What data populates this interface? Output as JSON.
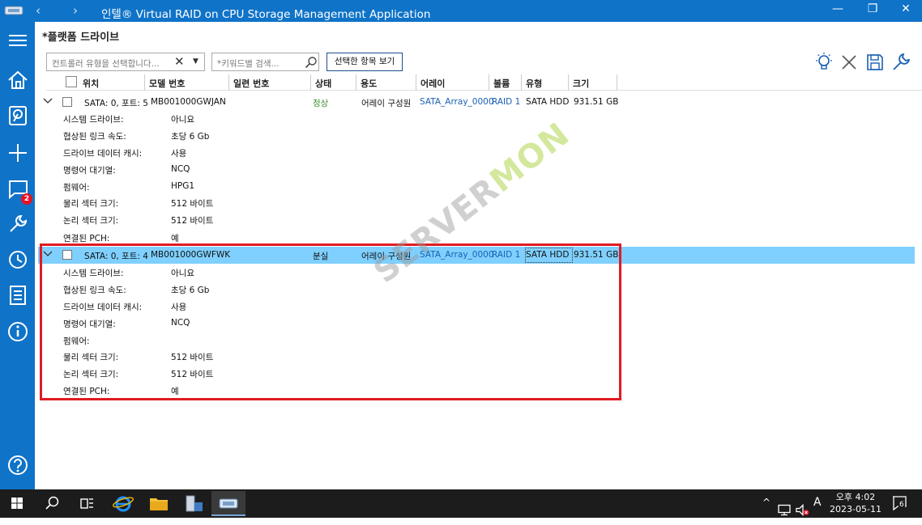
{
  "window": {
    "title": "인텔® Virtual RAID on CPU Storage Management Application",
    "back_glyph": "‹",
    "forward_glyph": "›",
    "minimize_glyph": "—",
    "restore_glyph": "❐",
    "close_glyph": "✕"
  },
  "rail": {
    "items": [
      "menu-icon",
      "home-icon",
      "storage-icon",
      "add-icon",
      "notifications-icon",
      "tools-icon",
      "history-icon",
      "document-icon",
      "info-icon",
      "help-icon"
    ],
    "notifications_badge": "2",
    "accent": "#0f73c8"
  },
  "page": {
    "section_title": "*플랫폼 드라이브",
    "controller_select_placeholder": "컨트롤러 유형을 선택합니다...",
    "clear_glyph": "✕",
    "dropdown_glyph": "▼",
    "search_placeholder": "*키워드별 검색...",
    "view_selected_button": "선택한 항목 보기"
  },
  "grid": {
    "columns": [
      "위치",
      "모델 번호",
      "일련 번호",
      "상태",
      "용도",
      "어레이",
      "볼륨",
      "유형",
      "크기"
    ],
    "rows": [
      {
        "location": "SATA: 0, 포트: 5",
        "model": "MB001000GWJAN",
        "serial": "",
        "status": "정상",
        "usage": "어레이 구성원",
        "array": "SATA_Array_0000",
        "volume": "RAID 1",
        "type": "SATA HDD",
        "size": "931.51 GB",
        "details": [
          {
            "label": "시스템 드라이브:",
            "value": "아니요"
          },
          {
            "label": "협상된 링크 속도:",
            "value": "초당 6 Gb"
          },
          {
            "label": "드라이브 데이터 캐시:",
            "value": "사용"
          },
          {
            "label": "명령어 대기열:",
            "value": "NCQ"
          },
          {
            "label": "펌웨어:",
            "value": "HPG1"
          },
          {
            "label": "물리 섹터 크기:",
            "value": "512 바이트"
          },
          {
            "label": "논리 섹터 크기:",
            "value": "512 바이트"
          },
          {
            "label": "연결된 PCH:",
            "value": "예"
          }
        ]
      },
      {
        "location": "SATA: 0, 포트: 4",
        "model": "MB001000GWFWK",
        "serial": "",
        "status": "분실",
        "usage": "어레이 구성원",
        "array": "SATA_Array_0000",
        "volume": "RAID 1",
        "type": "SATA HDD",
        "size": "931.51 GB",
        "details": [
          {
            "label": "시스템 드라이브:",
            "value": "아니요"
          },
          {
            "label": "협상된 링크 속도:",
            "value": "초당 6 Gb"
          },
          {
            "label": "드라이브 데이터 캐시:",
            "value": "사용"
          },
          {
            "label": "명령어 대기열:",
            "value": "NCQ"
          },
          {
            "label": "펌웨어:",
            "value": ""
          },
          {
            "label": "물리 섹터 크기:",
            "value": "512 바이트"
          },
          {
            "label": "논리 섹터 크기:",
            "value": "512 바이트"
          },
          {
            "label": "연결된 PCH:",
            "value": "예"
          }
        ]
      }
    ]
  },
  "watermark": {
    "part1": "SERVER",
    "part2": "MON"
  },
  "taskbar": {
    "ime": "A",
    "time": "오후 4:02",
    "date": "2023-05-11",
    "notification_count": "6",
    "tray_chevron": "^"
  }
}
